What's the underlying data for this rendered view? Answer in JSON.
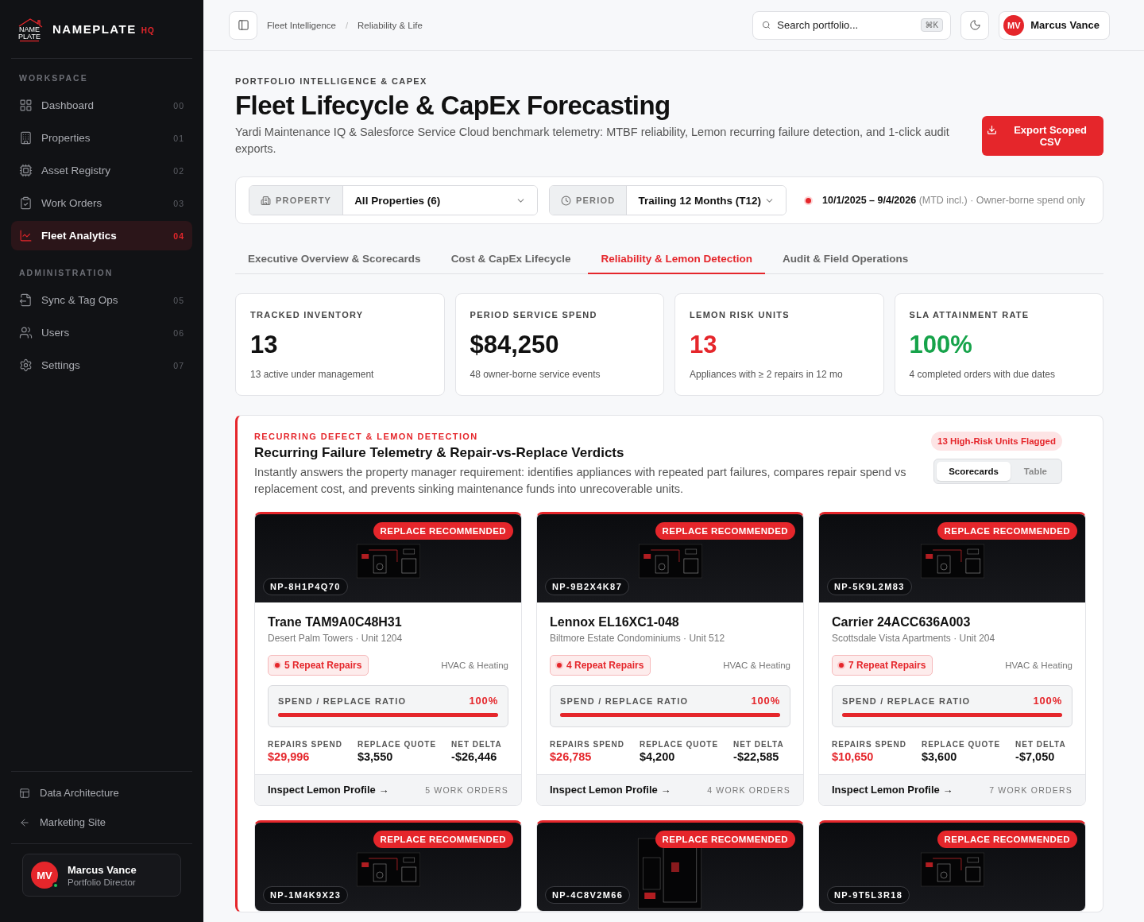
{
  "brand": {
    "logo_lines": [
      "NAME",
      "PLATE"
    ],
    "name": "NAMEPLATE",
    "suffix": "HQ"
  },
  "sidebar": {
    "sections": [
      {
        "title": "WORKSPACE",
        "items": [
          {
            "label": "Dashboard",
            "index": "00",
            "selected": false
          },
          {
            "label": "Properties",
            "index": "01",
            "selected": false
          },
          {
            "label": "Asset Registry",
            "index": "02",
            "selected": false
          },
          {
            "label": "Work Orders",
            "index": "03",
            "selected": false
          },
          {
            "label": "Fleet Analytics",
            "index": "04",
            "selected": true
          }
        ]
      },
      {
        "title": "ADMINISTRATION",
        "items": [
          {
            "label": "Sync & Tag Ops",
            "index": "05",
            "selected": false
          },
          {
            "label": "Users",
            "index": "06",
            "selected": false
          },
          {
            "label": "Settings",
            "index": "07",
            "selected": false
          }
        ]
      }
    ],
    "footer_links": [
      "Data Architecture",
      "Marketing Site"
    ],
    "user": {
      "initials": "MV",
      "name": "Marcus Vance",
      "role": "Portfolio Director",
      "online": true
    }
  },
  "topbar": {
    "breadcrumbs": [
      "Fleet Intelligence",
      "Reliability & Life"
    ],
    "breadcrumb_separator": "/",
    "search": {
      "placeholder": "Search portfolio...",
      "shortcut": "⌘K"
    },
    "user": {
      "initials": "MV",
      "name": "Marcus Vance"
    }
  },
  "page": {
    "eyebrow": "PORTFOLIO INTELLIGENCE & CAPEX",
    "title": "Fleet Lifecycle & CapEx Forecasting",
    "description": "Yardi Maintenance IQ & Salesforce Service Cloud benchmark telemetry: MTBF reliability, Lemon recurring failure detection, and 1-click audit exports.",
    "export_button": "Export Scoped CSV"
  },
  "filters": {
    "property": {
      "label": "PROPERTY",
      "value": "All Properties (6)"
    },
    "period": {
      "label": "PERIOD",
      "value": "Trailing 12 Months (T12)"
    },
    "range": "**10/1/2025 – 9/4/2026** (MTD incl.) · Owner-borne spend only"
  },
  "tabs": [
    {
      "label": "Executive Overview & Scorecards",
      "selected": false
    },
    {
      "label": "Cost & CapEx Lifecycle",
      "selected": false
    },
    {
      "label": "Reliability & Lemon Detection",
      "selected": true
    },
    {
      "label": "Audit & Field Operations",
      "selected": false
    }
  ],
  "kpis": [
    {
      "label": "TRACKED INVENTORY",
      "value": "13",
      "note": "13 active under management",
      "color": "#111111"
    },
    {
      "label": "PERIOD SERVICE SPEND",
      "value": "$84,250",
      "note": "48 owner-borne service events",
      "color": "#111111"
    },
    {
      "label": "LEMON RISK UNITS",
      "value": "13",
      "note": "Appliances with ≥ 2 repairs in 12 mo",
      "color": "#e5262b"
    },
    {
      "label": "SLA ATTAINMENT RATE",
      "value": "100%",
      "note": "4 completed orders with due dates",
      "color": "#16a34a"
    }
  ],
  "lemon": {
    "eyebrow": "RECURRING DEFECT & LEMON DETECTION",
    "title": "Recurring Failure Telemetry & Repair-vs-Replace Verdicts",
    "description": "Instantly answers the property manager requirement: identifies appliances with repeated part failures, compares repair spend vs replacement cost, and prevents sinking maintenance funds into unrecoverable units.",
    "flag": "13 High-Risk Units Flagged",
    "views": [
      {
        "label": "Scorecards",
        "selected": true
      },
      {
        "label": "Table",
        "selected": false
      }
    ],
    "cards": [
      {
        "tag": "NP-8H1P4Q70",
        "verdict": "REPLACE RECOMMENDED",
        "title": "Trane TAM9A0C48H31",
        "location": "Desert Palm Towers · Unit 1204",
        "repeats": "5 Repeat Repairs",
        "category": "HVAC & Heating",
        "ratio_label": "SPEND / REPLACE RATIO",
        "ratio": "100%",
        "level": 1,
        "stats": [
          {
            "label": "REPAIRS SPEND",
            "value": "$29,996"
          },
          {
            "label": "REPLACE QUOTE",
            "value": "$3,550"
          },
          {
            "label": "NET DELTA",
            "value": "-$26,446"
          }
        ],
        "link": "Inspect Lemon Profile →",
        "orders": "5 WORK ORDERS"
      },
      {
        "tag": "NP-9B2X4K87",
        "verdict": "REPLACE RECOMMENDED",
        "title": "Lennox EL16XC1-048",
        "location": "Biltmore Estate Condominiums · Unit 512",
        "repeats": "4 Repeat Repairs",
        "category": "HVAC & Heating",
        "ratio_label": "SPEND / REPLACE RATIO",
        "ratio": "100%",
        "level": 1,
        "stats": [
          {
            "label": "REPAIRS SPEND",
            "value": "$26,785"
          },
          {
            "label": "REPLACE QUOTE",
            "value": "$4,200"
          },
          {
            "label": "NET DELTA",
            "value": "-$22,585"
          }
        ],
        "link": "Inspect Lemon Profile →",
        "orders": "4 WORK ORDERS"
      },
      {
        "tag": "NP-5K9L2M83",
        "verdict": "REPLACE RECOMMENDED",
        "title": "Carrier 24ACC636A003",
        "location": "Scottsdale Vista Apartments · Unit 204",
        "repeats": "7 Repeat Repairs",
        "category": "HVAC & Heating",
        "ratio_label": "SPEND / REPLACE RATIO",
        "ratio": "100%",
        "level": 1,
        "stats": [
          {
            "label": "REPAIRS SPEND",
            "value": "$10,650"
          },
          {
            "label": "REPLACE QUOTE",
            "value": "$3,600"
          },
          {
            "label": "NET DELTA",
            "value": "-$7,050"
          }
        ],
        "link": "Inspect Lemon Profile →",
        "orders": "7 WORK ORDERS"
      },
      {
        "tag": "NP-1M4K9X23",
        "verdict": "REPLACE RECOMMENDED"
      },
      {
        "tag": "NP-4C8V2M66",
        "verdict": "REPLACE RECOMMENDED"
      },
      {
        "tag": "NP-9T5L3R18",
        "verdict": "REPLACE RECOMMENDED"
      }
    ]
  }
}
